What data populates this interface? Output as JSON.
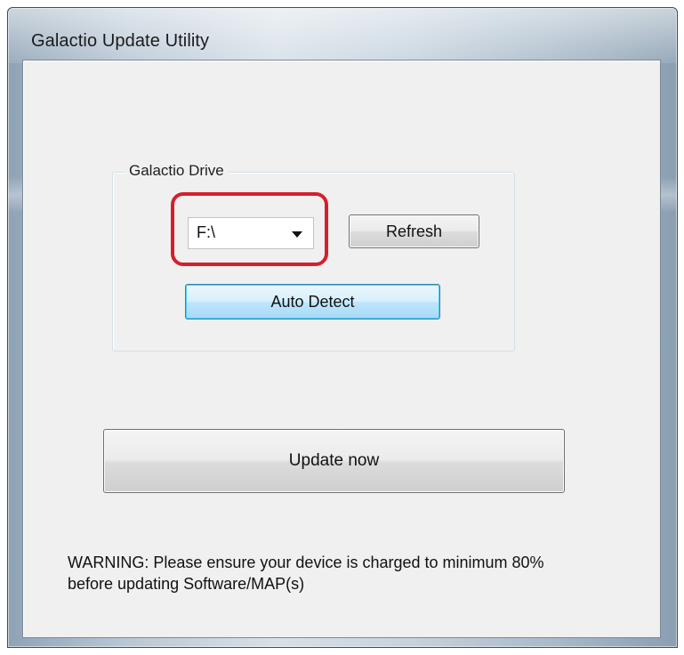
{
  "window": {
    "title": "Galactio Update Utility"
  },
  "drive_group": {
    "legend": "Galactio Drive",
    "drive_select": {
      "selected": "F:\\"
    },
    "refresh_label": "Refresh",
    "auto_detect_label": "Auto Detect",
    "annotation_color": "#d4202a"
  },
  "update_label": "Update now",
  "warning": {
    "line1": "WARNING: Please ensure your device is charged to minimum 80%",
    "line2": "before updating Software/MAP(s)"
  },
  "icons": {
    "dropdown": "chevron-down-icon"
  }
}
